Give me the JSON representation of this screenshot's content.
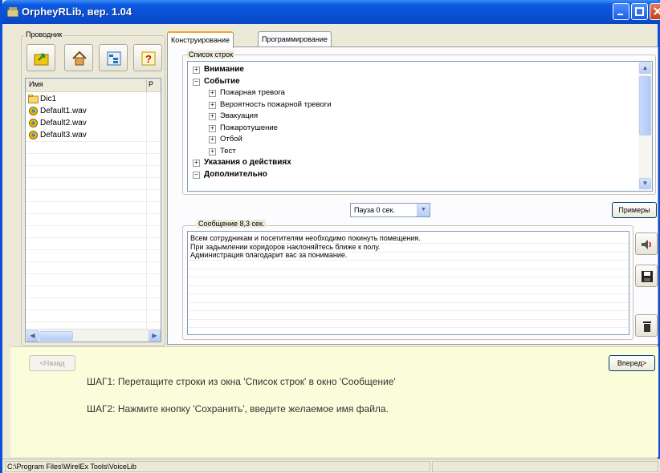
{
  "window": {
    "title": "OrpheyRLib, вер. 1.04"
  },
  "explorer": {
    "legend": "Проводник",
    "columns": [
      "Имя",
      "Р"
    ],
    "files": [
      {
        "name": "Dic1",
        "icon": "folder-icon"
      },
      {
        "name": "Default1.wav",
        "icon": "audio-file-icon"
      },
      {
        "name": "Default2.wav",
        "icon": "audio-file-icon"
      },
      {
        "name": "Default3.wav",
        "icon": "audio-file-icon"
      }
    ]
  },
  "tabs": [
    {
      "label": "Конструирование",
      "active": true
    },
    {
      "label": "Программирование",
      "active": false
    }
  ],
  "string_list": {
    "legend": "Список строк",
    "items": [
      {
        "label": "Внимание",
        "level": 0,
        "expander": "+",
        "bold": true
      },
      {
        "label": "Событие",
        "level": 0,
        "expander": "−",
        "bold": true
      },
      {
        "label": "Пожарная тревога",
        "level": 1,
        "expander": "+",
        "bold": false
      },
      {
        "label": "Вероятность пожарной тревоги",
        "level": 1,
        "expander": "+",
        "bold": false
      },
      {
        "label": "Эвакуация",
        "level": 1,
        "expander": "+",
        "bold": false
      },
      {
        "label": "Пожаротушение",
        "level": 1,
        "expander": "+",
        "bold": false
      },
      {
        "label": "Отбой",
        "level": 1,
        "expander": "+",
        "bold": false
      },
      {
        "label": "Тест",
        "level": 1,
        "expander": "+",
        "bold": false
      },
      {
        "label": "Указания о действиях",
        "level": 0,
        "expander": "+",
        "bold": true
      },
      {
        "label": "Дополнительно",
        "level": 0,
        "expander": "−",
        "bold": true
      }
    ]
  },
  "pause": {
    "selected": "Пауза 0 сек."
  },
  "examples_button": "Примеры",
  "message": {
    "legend": "Сообщение 8,3 сек.",
    "lines": [
      "Всем сотрудникам и посетителям необходимо покинуть помещения.",
      "При задымлении коридоров наклоняйтесь ближе к полу.",
      "Администрация благодарит вас за понимание."
    ]
  },
  "nav": {
    "back": "<Назад",
    "forward": "Вперед>"
  },
  "steps": {
    "step1": "ШАГ1: Перетащите строки из окна 'Список строк' в окно 'Сообщение'",
    "step2": "ШАГ2: Нажмите кнопку 'Сохранить', введите желаемое имя файла."
  },
  "status": {
    "path": "C:\\Program Files\\WirelEx Tools\\VoiceLib",
    "cell2": ""
  },
  "colors": {
    "titlebar": "#0a50d6",
    "panel_bg": "#ece9d8",
    "steps_bg": "#fbfcd9"
  }
}
